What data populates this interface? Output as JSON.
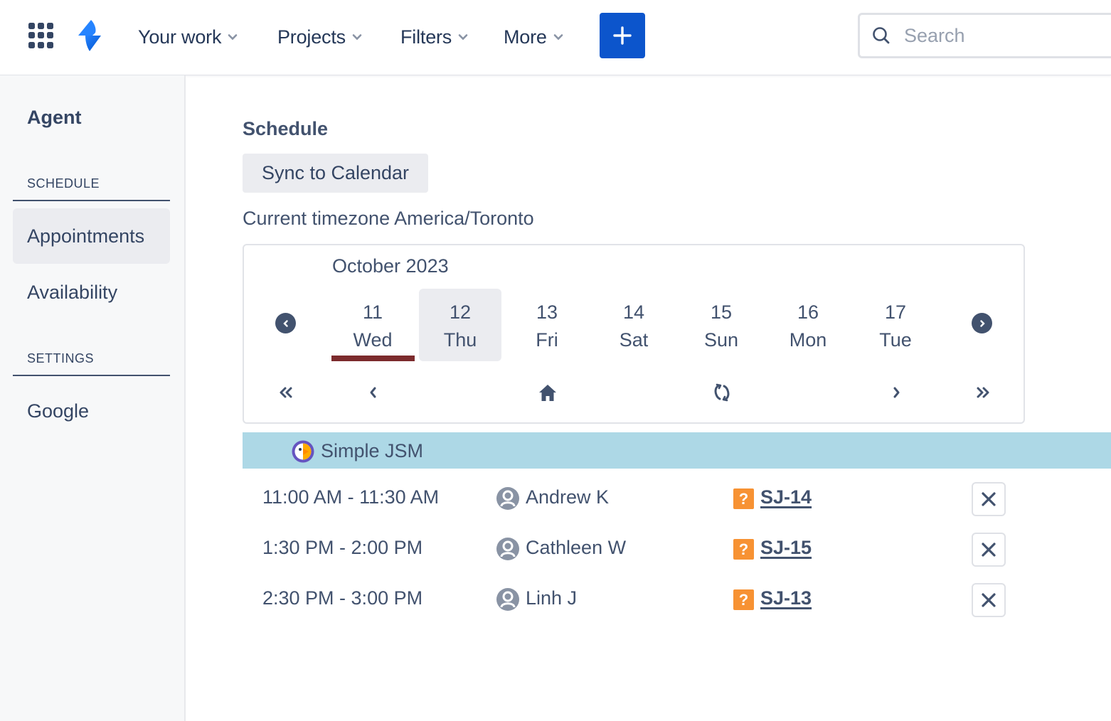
{
  "topnav": {
    "apps_icon": "app-switcher-grid-icon",
    "logo_icon": "jira-service-management-logo",
    "items": [
      {
        "label": "Your work"
      },
      {
        "label": "Projects"
      },
      {
        "label": "Filters"
      },
      {
        "label": "More"
      }
    ],
    "create_icon": "plus-icon",
    "search": {
      "placeholder": "Search",
      "value": ""
    },
    "colors": {
      "create_button": "#0c55cc",
      "text": "#253858"
    }
  },
  "sidebar": {
    "title": "Agent",
    "sections": [
      {
        "label": "SCHEDULE",
        "items": [
          {
            "label": "Appointments",
            "active": true
          },
          {
            "label": "Availability",
            "active": false
          }
        ]
      },
      {
        "label": "SETTINGS",
        "items": [
          {
            "label": "Google",
            "active": false
          }
        ]
      }
    ]
  },
  "main": {
    "title": "Schedule",
    "sync_button": "Sync to Calendar",
    "timezone": "Current timezone America/Toronto",
    "calendar": {
      "month": "October 2023",
      "days": [
        {
          "num": "11",
          "dow": "Wed",
          "today": true,
          "selected": false
        },
        {
          "num": "12",
          "dow": "Thu",
          "today": false,
          "selected": true
        },
        {
          "num": "13",
          "dow": "Fri",
          "today": false,
          "selected": false
        },
        {
          "num": "14",
          "dow": "Sat",
          "today": false,
          "selected": false
        },
        {
          "num": "15",
          "dow": "Sun",
          "today": false,
          "selected": false
        },
        {
          "num": "16",
          "dow": "Mon",
          "today": false,
          "selected": false
        },
        {
          "num": "17",
          "dow": "Tue",
          "today": false,
          "selected": false
        }
      ],
      "today_color": "#7c2b2d",
      "controls": [
        "double-chevron-left-icon",
        "chevron-left-icon",
        "home-icon",
        "refresh-icon",
        "chevron-right-icon",
        "double-chevron-right-icon"
      ]
    },
    "project": {
      "name": "Simple JSM",
      "bar_color": "#add8e6"
    },
    "appointments": [
      {
        "time": "11:00 AM - 11:30 AM",
        "person": "Andrew K",
        "issue_key": "SJ-14",
        "issue_type_glyph": "?"
      },
      {
        "time": "1:30 PM - 2:00 PM",
        "person": "Cathleen W",
        "issue_key": "SJ-15",
        "issue_type_glyph": "?"
      },
      {
        "time": "2:30 PM - 3:00 PM",
        "person": "Linh J",
        "issue_key": "SJ-13",
        "issue_type_glyph": "?"
      }
    ],
    "issue_type_color": "#f79233"
  }
}
